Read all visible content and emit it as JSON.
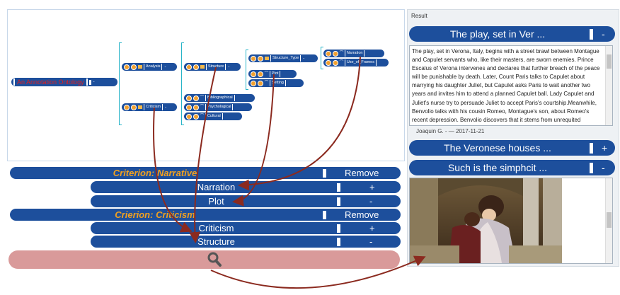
{
  "tree": {
    "root_label": "An Annotation Ontology",
    "root_collapse": "-",
    "nodes": {
      "analysis": "Analysis",
      "criticism": "Criticism",
      "structure": "Structure",
      "bibliographical": "Bibliographical",
      "psychological": "Psychological",
      "cultural": "Cultural",
      "structure_type": "Structure_Type",
      "plot": "Plot",
      "setting": "Setting",
      "narration": "Narration",
      "use_of_frames": "Use_of_Frames"
    },
    "collapse_symbol": "-"
  },
  "criteria": [
    {
      "title": "Criterion: Narrative",
      "action": "Remove",
      "items": [
        {
          "label": "Narration",
          "action": "+"
        },
        {
          "label": "Plot",
          "action": "-"
        }
      ]
    },
    {
      "title": "Crierion: Criticism",
      "action": "Remove",
      "items": [
        {
          "label": "Criticism",
          "action": "+"
        },
        {
          "label": "Structure",
          "action": "-"
        }
      ]
    }
  ],
  "search": {
    "icon": "search-icon"
  },
  "result": {
    "title": "Result",
    "entries": [
      {
        "label": "The play, set in Ver ...",
        "action": "-"
      },
      {
        "label": "The Veronese houses ...",
        "action": "+"
      },
      {
        "label": "Such is the simphcit ...",
        "action": "-"
      }
    ],
    "text": "The play, set in Verona, Italy, begins with a street brawl between Montague and Capulet servants who, like their masters, are sworn enemies. Prince Escalus of Verona intervenes and declares that further breach of the peace will be punishable by death. Later, Count Paris talks to Capulet about marrying his daughter Juliet, but Capulet asks Paris to wait another two years and invites him to attend a planned Capulet ball. Lady Capulet and Juliet's nurse try to persuade Juliet to accept Paris's courtship.Meanwhile, Benvolio talks with his cousin Romeo, Montague's son, about Romeo's recent depression. Benvolio discovers that it stems from unrequited infatuation for a girl named Rosaline, one of Capulet's",
    "author": "Joaquin G. - — 2017-11-21"
  },
  "colors": {
    "bar": "#1d4f9c",
    "criterion": "#f0a020",
    "search_bar": "#d99a9a",
    "arrow": "#8b2a1f",
    "root_label": "#e02020"
  }
}
